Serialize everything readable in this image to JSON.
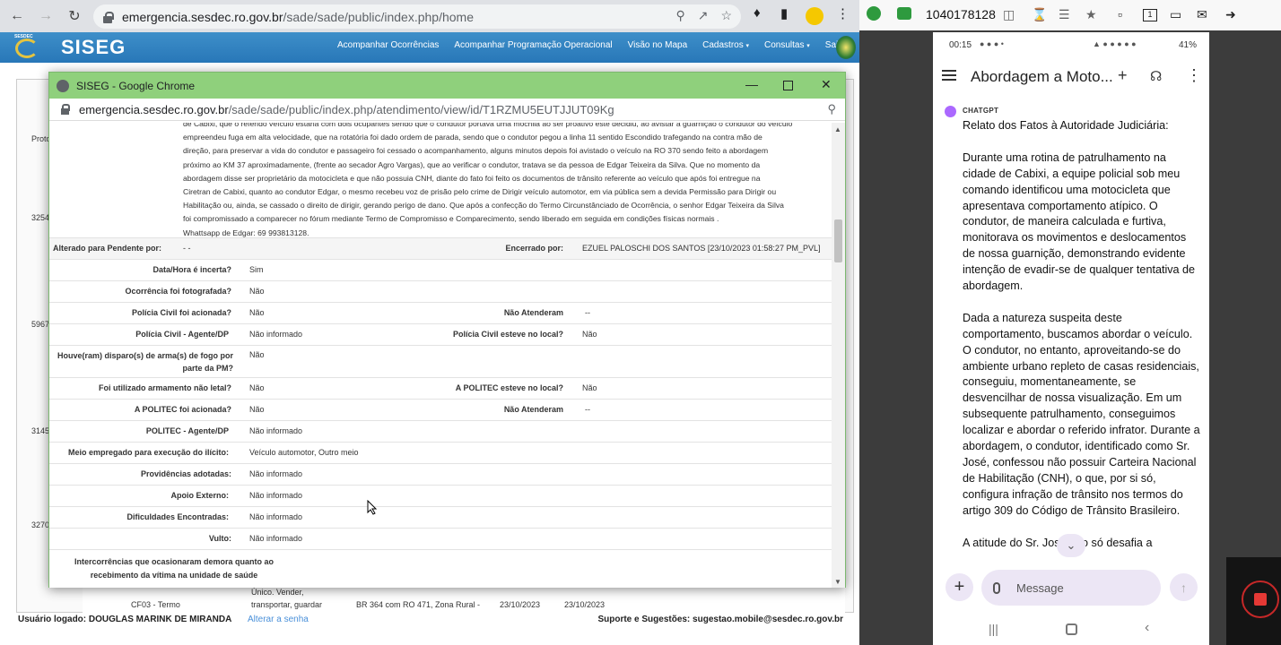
{
  "browser": {
    "url_host": "emergencia.sesdec.ro.gov.br",
    "url_path": "/sade/sade/public/index.php/home"
  },
  "siseg": {
    "logo_text": "SESDEC",
    "title": "SISEG",
    "menu": [
      "Acompanhar Ocorrências",
      "Acompanhar Programação Operacional",
      "Visão no Mapa",
      "Cadastros",
      "Consultas",
      "Sair"
    ]
  },
  "background_table": {
    "header_label": "Proto",
    "row_numbers": [
      "3254",
      "5967",
      "3145",
      "3270"
    ],
    "bottom_row": {
      "code": "CF03 - Termo",
      "desc1": "Único. Vender,",
      "desc2": "transportar, guardar",
      "address": "BR 364 com RO 471, Zona Rural -",
      "date1": "23/10/2023",
      "date2": "23/10/2023"
    }
  },
  "footer": {
    "user_label": "Usuário logado: DOUGLAS MARINK DE MIRANDA",
    "change_password": "Alterar a senha",
    "support": "Suporte e Sugestões: sugestao.mobile@sesdec.ro.gov.br"
  },
  "popup": {
    "window_title": "SISEG - Google Chrome",
    "url_host": "emergencia.sesdec.ro.gov.br",
    "url_path": "/sade/sade/public/index.php/atendimento/view/id/T1RZMU5EUTJJUT09Kg",
    "narrative": [
      "de Cabixi, que o referido veículo estaria com dois ocupantes sendo que o condutor portava uma mochila ao ser proativo este decidiu, ao avistar a guarnição o condutor do veículo",
      "empreendeu fuga em alta velocidade, que na rotatória foi dado ordem de parada, sendo que o condutor pegou a linha 11 sentido Escondido trafegando na contra mão de",
      "direção, para preservar a vida do condutor e passageiro foi cessado o acompanhamento, alguns minutos depois foi avistado o veículo na RO 370 sendo feito a abordagem",
      "próximo ao KM 37 aproximadamente, (frente ao secador Agro Vargas), que ao verificar o condutor, tratava se da pessoa de Edgar Teixeira da Silva. Que no momento da",
      "abordagem disse ser proprietário da motocicleta e que não possuia CNH, diante do fato foi feito os documentos de trânsito referente ao veículo que após foi entregue na",
      "Ciretran de Cabixi, quanto ao condutor Edgar, o mesmo recebeu voz de prisão pelo crime de Dirigir veículo automotor, em via pública sem a devida Permissão para Dirigir ou",
      "Habilitação ou, ainda, se cassado o direito de dirigir, gerando perigo de dano. Que após a confecção do Termo Circunstânciado de Ocorrência, o senhor Edgar Teixeira da Silva",
      "foi compromissado a comparecer no fórum mediante Termo de Compromisso e Comparecimento, sendo liberado em seguida em condições físicas normais .",
      "Whattsapp de Edgar: 69 993813128."
    ],
    "fields": {
      "alterado_label": "Alterado para Pendente por:",
      "alterado_value": "- -",
      "encerrado_label": "Encerrado por:",
      "encerrado_value": "EZUEL PALOSCHI DOS SANTOS [23/10/2023 01:58:27 PM_PVL]",
      "data_hora_label": "Data/Hora é incerta?",
      "data_hora_value": "Sim",
      "fotografada_label": "Ocorrência foi fotografada?",
      "fotografada_value": "Não",
      "pc_acionada_label": "Polícia Civil foi acionada?",
      "pc_acionada_value": "Não",
      "nao_atenderam_label": "Não Atenderam",
      "nao_atenderam_value": "--",
      "pc_agente_label": "Polícia Civil - Agente/DP",
      "pc_agente_value": "Não informado",
      "pc_local_label": "Polícia Civil esteve no local?",
      "pc_local_value": "Não",
      "disparo_label1": "Houve(ram) disparo(s) de arma(s) de fogo por",
      "disparo_label2": "parte da PM?",
      "disparo_value": "Não",
      "nao_letal_label": "Foi utilizado armamento não letal?",
      "nao_letal_value": "Não",
      "politec_local_label": "A POLITEC esteve no local?",
      "politec_local_value": "Não",
      "politec_acionada_label": "A POLITEC foi acionada?",
      "politec_acionada_value": "Não",
      "nao_atenderam2_label": "Não Atenderam",
      "nao_atenderam2_value": "--",
      "politec_agente_label": "POLITEC - Agente/DP",
      "politec_agente_value": "Não informado",
      "meio_label": "Meio empregado para execução do ilícito:",
      "meio_value": "Veículo automotor, Outro meio",
      "providencias_label": "Providências adotadas:",
      "providencias_value": "Não informado",
      "apoio_label": "Apoio Externo:",
      "apoio_value": "Não informado",
      "dificuldades_label": "Dificuldades Encontradas:",
      "dificuldades_value": "Não informado",
      "vulto_label": "Vulto:",
      "vulto_value": "Não informado",
      "intercorrencias_label1": "Intercorrências que ocasionaram demora quanto ao",
      "intercorrencias_label2": "recebimento da vítima na unidade de saúde"
    }
  },
  "remote": {
    "id_number": "1040178128"
  },
  "phone": {
    "time": "00:15",
    "battery": "41%",
    "app_title": "Abordagem a Moto...",
    "sender": "CHATGPT",
    "paragraphs": [
      "Relato dos Fatos à Autoridade Judiciária:",
      "Durante uma rotina de patrulhamento na cidade de Cabixi, a equipe policial sob meu comando identificou uma motocicleta que apresentava comportamento atípico. O condutor, de maneira calculada e furtiva, monitorava os movimentos e deslocamentos de nossa guarnição, demonstrando evidente intenção de evadir-se de qualquer tentativa de abordagem.",
      "Dada a natureza suspeita deste comportamento, buscamos abordar o veículo. O condutor, no entanto, aproveitando-se do ambiente urbano repleto de casas residenciais, conseguiu, momentaneamente, se desvencilhar de nossa visualização. Em um subsequente patrulhamento, conseguimos localizar e abordar o referido infrator. Durante a abordagem, o condutor, identificado como Sr. José, confessou não possuir Carteira Nacional de Habilitação (CNH), o que, por si só, configura infração de trânsito nos termos do artigo 309 do Código de Trânsito Brasileiro.",
      "A atitude do Sr. José não só desafia a"
    ],
    "message_placeholder": "Message"
  },
  "colors": {
    "siseg_blue": "#2f80c0",
    "popup_title_green": "#8fd07c",
    "chat_accent": "#ab68ff",
    "record_red": "#e53935"
  }
}
